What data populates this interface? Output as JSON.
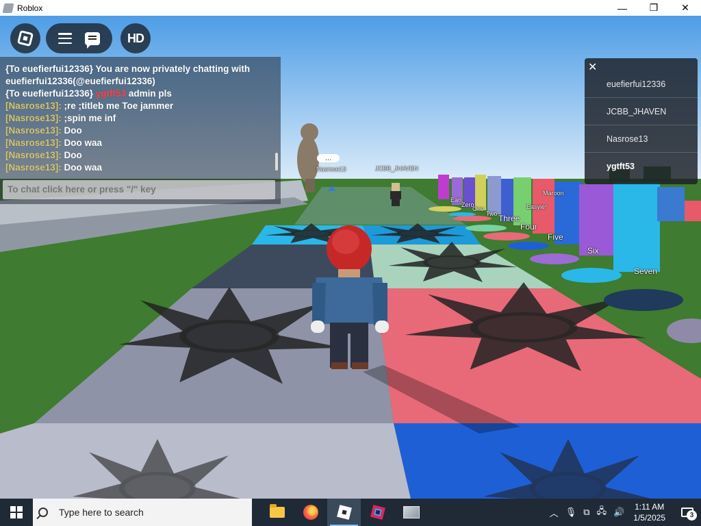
{
  "window": {
    "title": "Roblox",
    "controls": {
      "minimize": "—",
      "maximize": "❐",
      "close": "✕"
    }
  },
  "topbar": {
    "hd_label": "HD"
  },
  "chat": {
    "lines": [
      {
        "text": "{To euefierfui12336} You are now privately chatting with euefierfui12336(@euefierfui12336)"
      },
      {
        "prefix": "{To euefierfui12336} ",
        "name": "ygtft53",
        "text": " admin pls"
      },
      {
        "name": "[Nasrose13]:",
        "text": " ;re ;titleb me Toe jammer"
      },
      {
        "name": "[Nasrose13]:",
        "text": " ;spin me inf"
      },
      {
        "name": "[Nasrose13]:",
        "text": " Doo"
      },
      {
        "name": "[Nasrose13]:",
        "text": " Doo waa"
      },
      {
        "name": "[Nasrose13]:",
        "text": " Doo"
      },
      {
        "name": "[Nasrose13]:",
        "text": " Doo waa"
      }
    ],
    "input_placeholder": "To chat click here or press \"/\" key"
  },
  "player_list": {
    "close": "✕",
    "players": [
      "euefierfui12336",
      "JCBB_JHAVEN",
      "Nasrose13",
      "ygtft53"
    ]
  },
  "world": {
    "bubble": "...",
    "nametags": [
      "Nasrose13",
      "JCBB_JHAVEN",
      "Maroon",
      "Easyie!",
      "Ean",
      "Zero",
      "One",
      "Two",
      "Three",
      "Four",
      "Five",
      "Six",
      "Seven"
    ]
  },
  "taskbar": {
    "search_placeholder": "Type here to search",
    "apps": [
      "file-explorer",
      "firefox",
      "roblox",
      "roblox-studio",
      "other-app"
    ],
    "time": "1:11 AM",
    "date": "1/5/2025",
    "notifications": "3",
    "tray_icons": [
      "chevron-up",
      "microphone",
      "screen-clip",
      "network",
      "volume"
    ]
  },
  "colors": {
    "sky_top": "#5aa6e8",
    "grass": "#3e7a2f",
    "tile_pink": "#e86a78",
    "tile_blue": "#1f5fd6",
    "tile_gray": "#8f93a8",
    "tile_lightblue": "#2ab8e8"
  }
}
